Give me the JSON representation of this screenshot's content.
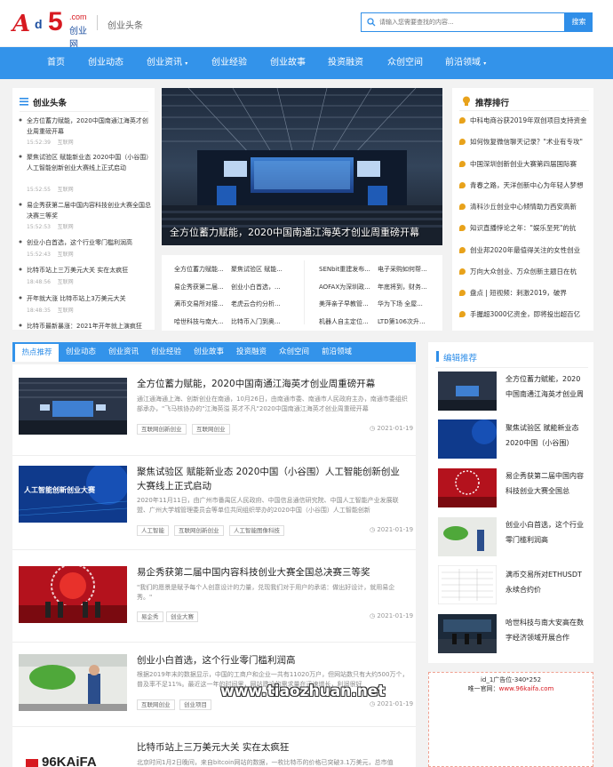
{
  "header": {
    "logo": {
      "a": "A",
      "d": "d",
      "five": "5",
      "com": ".com",
      "cn": "创业网"
    },
    "section_title": "创业头条",
    "search_placeholder": "请输入您需要查找的内容...",
    "search_button": "搜索"
  },
  "nav": [
    "首页",
    "创业动态",
    "创业资讯",
    "创业经验",
    "创业故事",
    "投资融资",
    "众创空间",
    "前沿领域"
  ],
  "headlines": {
    "title": "创业头条",
    "items": [
      {
        "title": "全方位蓄力赋能，2020中国南通江海英才创业周重磅开幕",
        "time": "15:52:39",
        "src": "互联网"
      },
      {
        "title": "聚焦试验区 赋能新业态 2020中国（小谷围）人工智能创新创业大赛线上正式启动",
        "time": "15:52:55",
        "src": "互联网"
      },
      {
        "title": "易企秀获第二届中国内容科技创业大赛全国总决赛三等奖",
        "time": "15:52:53",
        "src": "互联网"
      },
      {
        "title": "创业小白首选，这个行业零门槛利润高",
        "time": "15:52:43",
        "src": "互联网"
      },
      {
        "title": "比特币站上三万美元大关 实在太疯狂",
        "time": "18:48:56",
        "src": "互联网"
      },
      {
        "title": "开年就大涨 比特币站上3万美元大关",
        "time": "18:48:35",
        "src": "互联网"
      },
      {
        "title": "比特币最新暴涨：2021年开年就上演疯狂",
        "time": "",
        "src": ""
      }
    ]
  },
  "hero": {
    "caption": "全方位蓄力赋能，2020中国南通江海英才创业周重磅开幕"
  },
  "grid_links": [
    [
      "全方位蓄力赋能...",
      "聚焦试验区 赋能...",
      "SENbit重建发布...",
      "电子采购如何帮..."
    ],
    [
      "易企秀获第二届...",
      "创业小白首选，...",
      "AOFAX为深圳政...",
      "年底将到，财务..."
    ],
    [
      "满币交易所对接...",
      "老虎云合约分析...",
      "美萍亲子早教管...",
      "华为下场 全屋..."
    ],
    [
      "哈世科技与南大...",
      "比特币入门到奥...",
      "机器人自主定位...",
      "LTD第106次升..."
    ]
  ],
  "ranking": {
    "title": "推荐排行",
    "items": [
      "中科电商谷获2019年双创项目支持资金",
      "如何恢复微信聊天记录？\"术业有专攻\"",
      "中国深圳创新创业大赛第四届国际赛",
      "青春之路，天洋创新中心为年轻人梦想",
      "清科沙丘创业中心倾情助力西安高新",
      "知识直播悖论之年：\"娱乐至死\"的抗",
      "创业邦2020年最值得关注的女性创业",
      "万向大众创业、万众创新主题日在杭",
      "盘点 | 短视频：刺激2019，破界",
      "手握超3000亿资金，即将投出超百亿"
    ]
  },
  "tabs": [
    "热点推荐",
    "创业动态",
    "创业资讯",
    "创业经验",
    "创业故事",
    "投资融资",
    "众创空间",
    "前沿领域"
  ],
  "articles": [
    {
      "title": "全方位蓄力赋能，2020中国南通江海英才创业周重磅开幕",
      "desc": "通江通海通上海、创新创业在南通，10月26日，由南通市委、南通市人民政府主办，南通市委组织部承办，\"飞马核协办的\"江海英溢 英才不凡\"2020中国南通江海英才创业周重磅开幕",
      "tags": [
        "互联网创新创业",
        "互联网创业"
      ],
      "date": "2021-01-19"
    },
    {
      "title": "聚焦试验区 赋能新业态 2020中国（小谷围）人工智能创新创业大赛线上正式启动",
      "desc": "2020年11月11日，由广州市番禺区人民政府、中国信息通信研究院、中国人工智能产业发展联盟、广州大学城管理委员会等单位共同组织举办的2020中国（小谷围）人工智能创新",
      "tags": [
        "人工智能",
        "互联网创新创业",
        "人工智能图像科技"
      ],
      "date": "2021-01-19"
    },
    {
      "title": "易企秀获第二届中国内容科技创业大赛全国总决赛三等奖",
      "desc": "\"我们的愿景是赋予每个人创意设计的力量，兑现我们对于用户的承诺：做出好设计，就用易企秀。\"",
      "tags": [
        "易企秀",
        "创业大赛"
      ],
      "date": "2021-01-19"
    },
    {
      "title": "创业小白首选，这个行业零门槛利润高",
      "desc": "根据2019年末的数据显示，中国的工商户和企业一共有11020万户，但网站数只有大约500万个，普及率不足11%。最近这一年的时间里，网站建设的需求量在迅速增长，利润很好",
      "tags": [
        "互联网创业",
        "创业项目"
      ],
      "date": "2021-01-19"
    },
    {
      "title": "比特币站上三万美元大关 实在太疯狂",
      "desc": "北京时间1月2日晚间，来自bitcoin网站的数据，一枚比特币的价格已突破3.1万美元，总市值",
      "tags": [],
      "date": ""
    }
  ],
  "editor": {
    "title": "编辑推荐",
    "items": [
      "全方位蓄力赋能，2020中国南通江海英才创业周",
      "聚焦试验区 赋能新业态 2020中国（小谷围）",
      "易企秀获第二届中国内容科技创业大赛全国总",
      "创业小白首选，这个行业零门槛利润高",
      "满币交易所对ETHUSDT永续合约价",
      "哈世科技与南大安高在数字经济领域开展合作"
    ]
  },
  "ad": {
    "line1": "id_1广告位-340*252",
    "line2_prefix": "唯一官网：",
    "line2_link": "www.96kaifa.com"
  },
  "watermark": "www.tiaozhuan.net",
  "thumb_text": {
    "kaifa": "96KAiFA",
    "ai_title": "人工智能创新创业大赛"
  },
  "colors": {
    "accent": "#3393ea",
    "brand_red": "#d71920",
    "rank_icon": "#e8a21b"
  }
}
